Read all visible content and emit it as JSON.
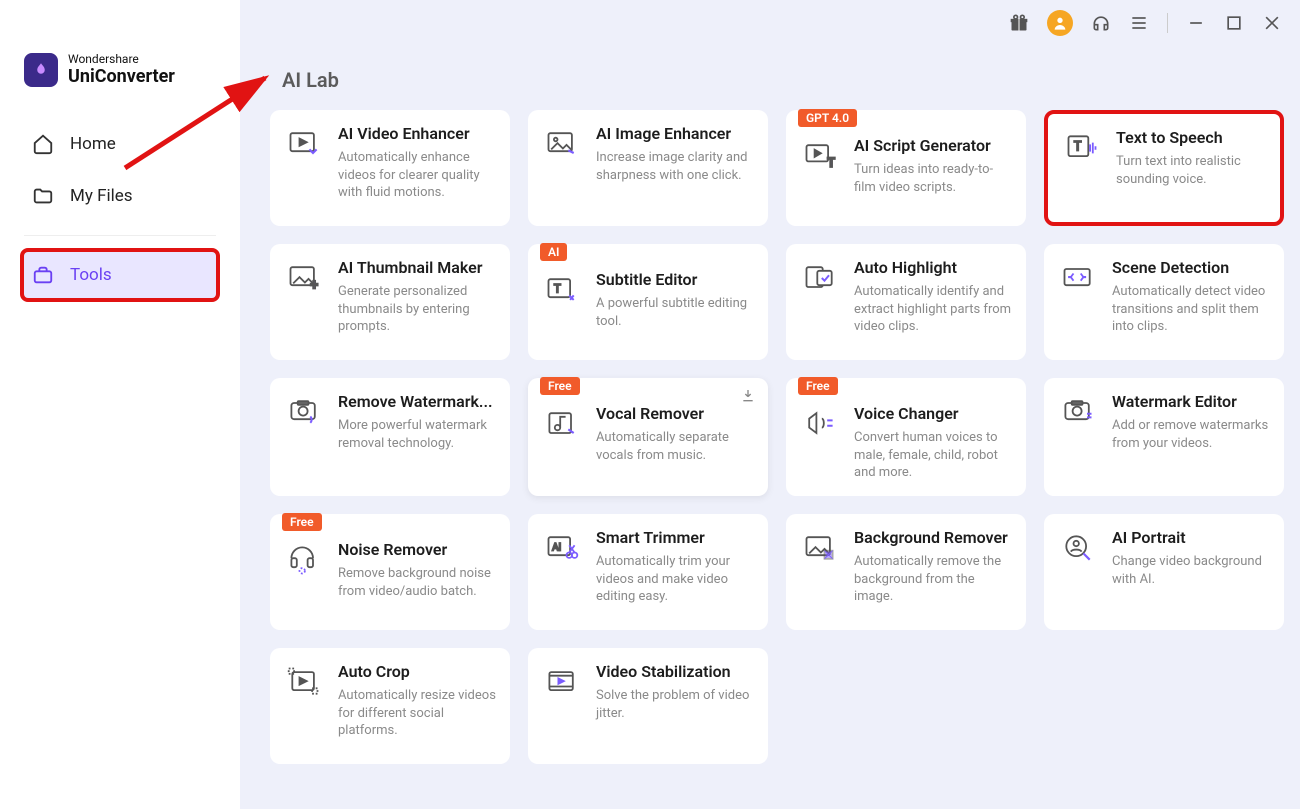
{
  "app": {
    "brand_top": "Wondershare",
    "brand_bottom": "UniConverter"
  },
  "sidebar": {
    "items": [
      {
        "label": "Home"
      },
      {
        "label": "My Files"
      },
      {
        "label": "Tools"
      }
    ]
  },
  "section_title": "AI Lab",
  "badges": {
    "gpt": "GPT 4.0",
    "ai": "AI",
    "free": "Free"
  },
  "cards": [
    {
      "title": "AI Video Enhancer",
      "desc": "Automatically enhance videos for clearer quality with fluid motions."
    },
    {
      "title": "AI Image Enhancer",
      "desc": "Increase image clarity and sharpness with one click."
    },
    {
      "title": "AI Script Generator",
      "desc": "Turn ideas into ready-to-film video scripts."
    },
    {
      "title": "Text to Speech",
      "desc": "Turn text into realistic sounding voice."
    },
    {
      "title": "AI Thumbnail Maker",
      "desc": "Generate personalized thumbnails by entering prompts."
    },
    {
      "title": "Subtitle Editor",
      "desc": "A powerful subtitle editing tool."
    },
    {
      "title": "Auto Highlight",
      "desc": "Automatically identify and extract highlight parts from video clips."
    },
    {
      "title": "Scene Detection",
      "desc": "Automatically detect video transitions and split them into clips."
    },
    {
      "title": "Remove Watermark...",
      "desc": "More powerful watermark removal technology."
    },
    {
      "title": "Vocal Remover",
      "desc": "Automatically separate vocals from music."
    },
    {
      "title": "Voice Changer",
      "desc": "Convert human voices to male, female, child, robot and more."
    },
    {
      "title": "Watermark Editor",
      "desc": "Add or remove watermarks from your videos."
    },
    {
      "title": "Noise Remover",
      "desc": "Remove background noise from video/audio batch."
    },
    {
      "title": "Smart Trimmer",
      "desc": "Automatically trim your videos and make video editing easy."
    },
    {
      "title": "Background Remover",
      "desc": "Automatically remove the background from the image."
    },
    {
      "title": "AI Portrait",
      "desc": "Change video background with AI."
    },
    {
      "title": "Auto Crop",
      "desc": "Automatically resize videos for different social platforms."
    },
    {
      "title": "Video Stabilization",
      "desc": "Solve the problem of video jitter."
    }
  ]
}
